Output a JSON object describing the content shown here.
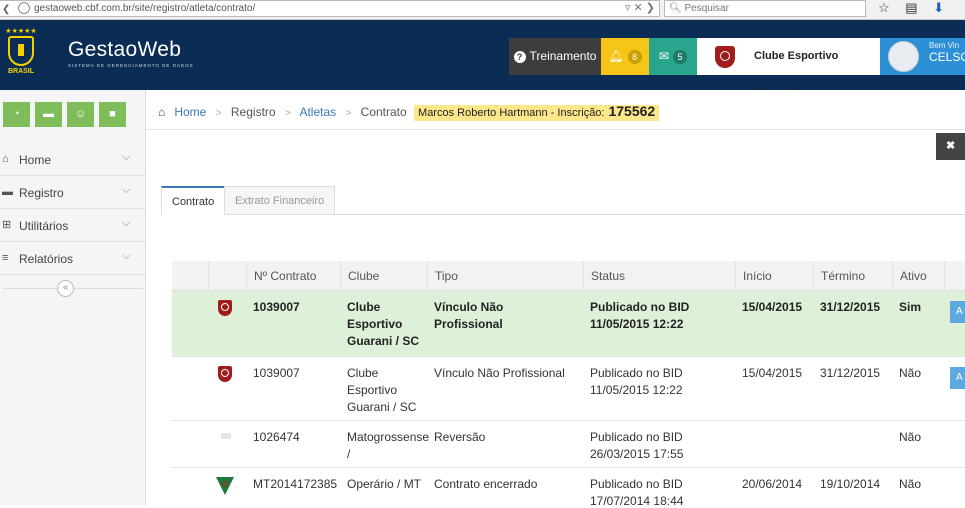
{
  "browser": {
    "url": "gestaoweb.cbf.com.br/site/registro/atleta/contrato/",
    "search_placeholder": "Pesquisar"
  },
  "header": {
    "logo_text": "BRASIL",
    "brand_name": "GestaoWeb",
    "brand_sub": "SISTEMA DE GERENCIAMENTO DE DADOS",
    "training_label": "Treinamento",
    "notifications_count": "8",
    "messages_count": "5",
    "club_name": "Clube Esportivo Guarani",
    "welcome_text": "Bem Vin",
    "user_name": "CELSO"
  },
  "sidebar": {
    "items": [
      {
        "label": "Home",
        "icon": "home-icon"
      },
      {
        "label": "Registro",
        "icon": "folder-icon"
      },
      {
        "label": "Utilitários",
        "icon": "grid-icon"
      },
      {
        "label": "Relatórios",
        "icon": "list-icon"
      }
    ]
  },
  "breadcrumb": {
    "home": "Home",
    "registro": "Registro",
    "atletas": "Atletas",
    "contrato": "Contrato",
    "athlete_label": "Marcos Roberto Hartmann - Inscrição:",
    "athlete_id": "175562"
  },
  "tabs": [
    "Contrato",
    "Extrato Financeiro"
  ],
  "table": {
    "headers": [
      "Nº Contrato",
      "Clube",
      "Tipo",
      "Status",
      "Início",
      "Término",
      "Ativo"
    ],
    "rows": [
      {
        "numero": "1039007",
        "clube": "Clube Esportivo Guarani / SC",
        "tipo": "Vínculo Não Profissional",
        "status": "Publicado no BID 11/05/2015 12:22",
        "inicio": "15/04/2015",
        "termino": "31/12/2015",
        "ativo": "Sim",
        "highlight": true
      },
      {
        "numero": "1039007",
        "clube": "Clube Esportivo Guarani / SC",
        "tipo": "Vínculo Não Profissional",
        "status": "Publicado no BID 11/05/2015 12:22",
        "inicio": "15/04/2015",
        "termino": "31/12/2015",
        "ativo": "Não",
        "highlight": false
      },
      {
        "numero": "1026474",
        "clube": "Matogrossense /",
        "tipo": "Reversão",
        "status": "Publicado no BID 26/03/2015 17:55",
        "inicio": "",
        "termino": "",
        "ativo": "Não",
        "highlight": false
      },
      {
        "numero": "MT2014172385",
        "clube": "Operário / MT",
        "tipo": "Contrato encerrado",
        "status": "Publicado no BID 17/07/2014 18:44",
        "inicio": "20/06/2014",
        "termino": "19/10/2014",
        "ativo": "Não",
        "highlight": false
      }
    ]
  },
  "colors": {
    "header_bg": "#0b2d55",
    "notif": "#f5c518",
    "messages": "#2aa58d",
    "user": "#2d8fd6",
    "quick_buttons": "#7fbd5a",
    "row_highlight": "#dff0d8",
    "crumb_highlight": "#fce78b"
  }
}
